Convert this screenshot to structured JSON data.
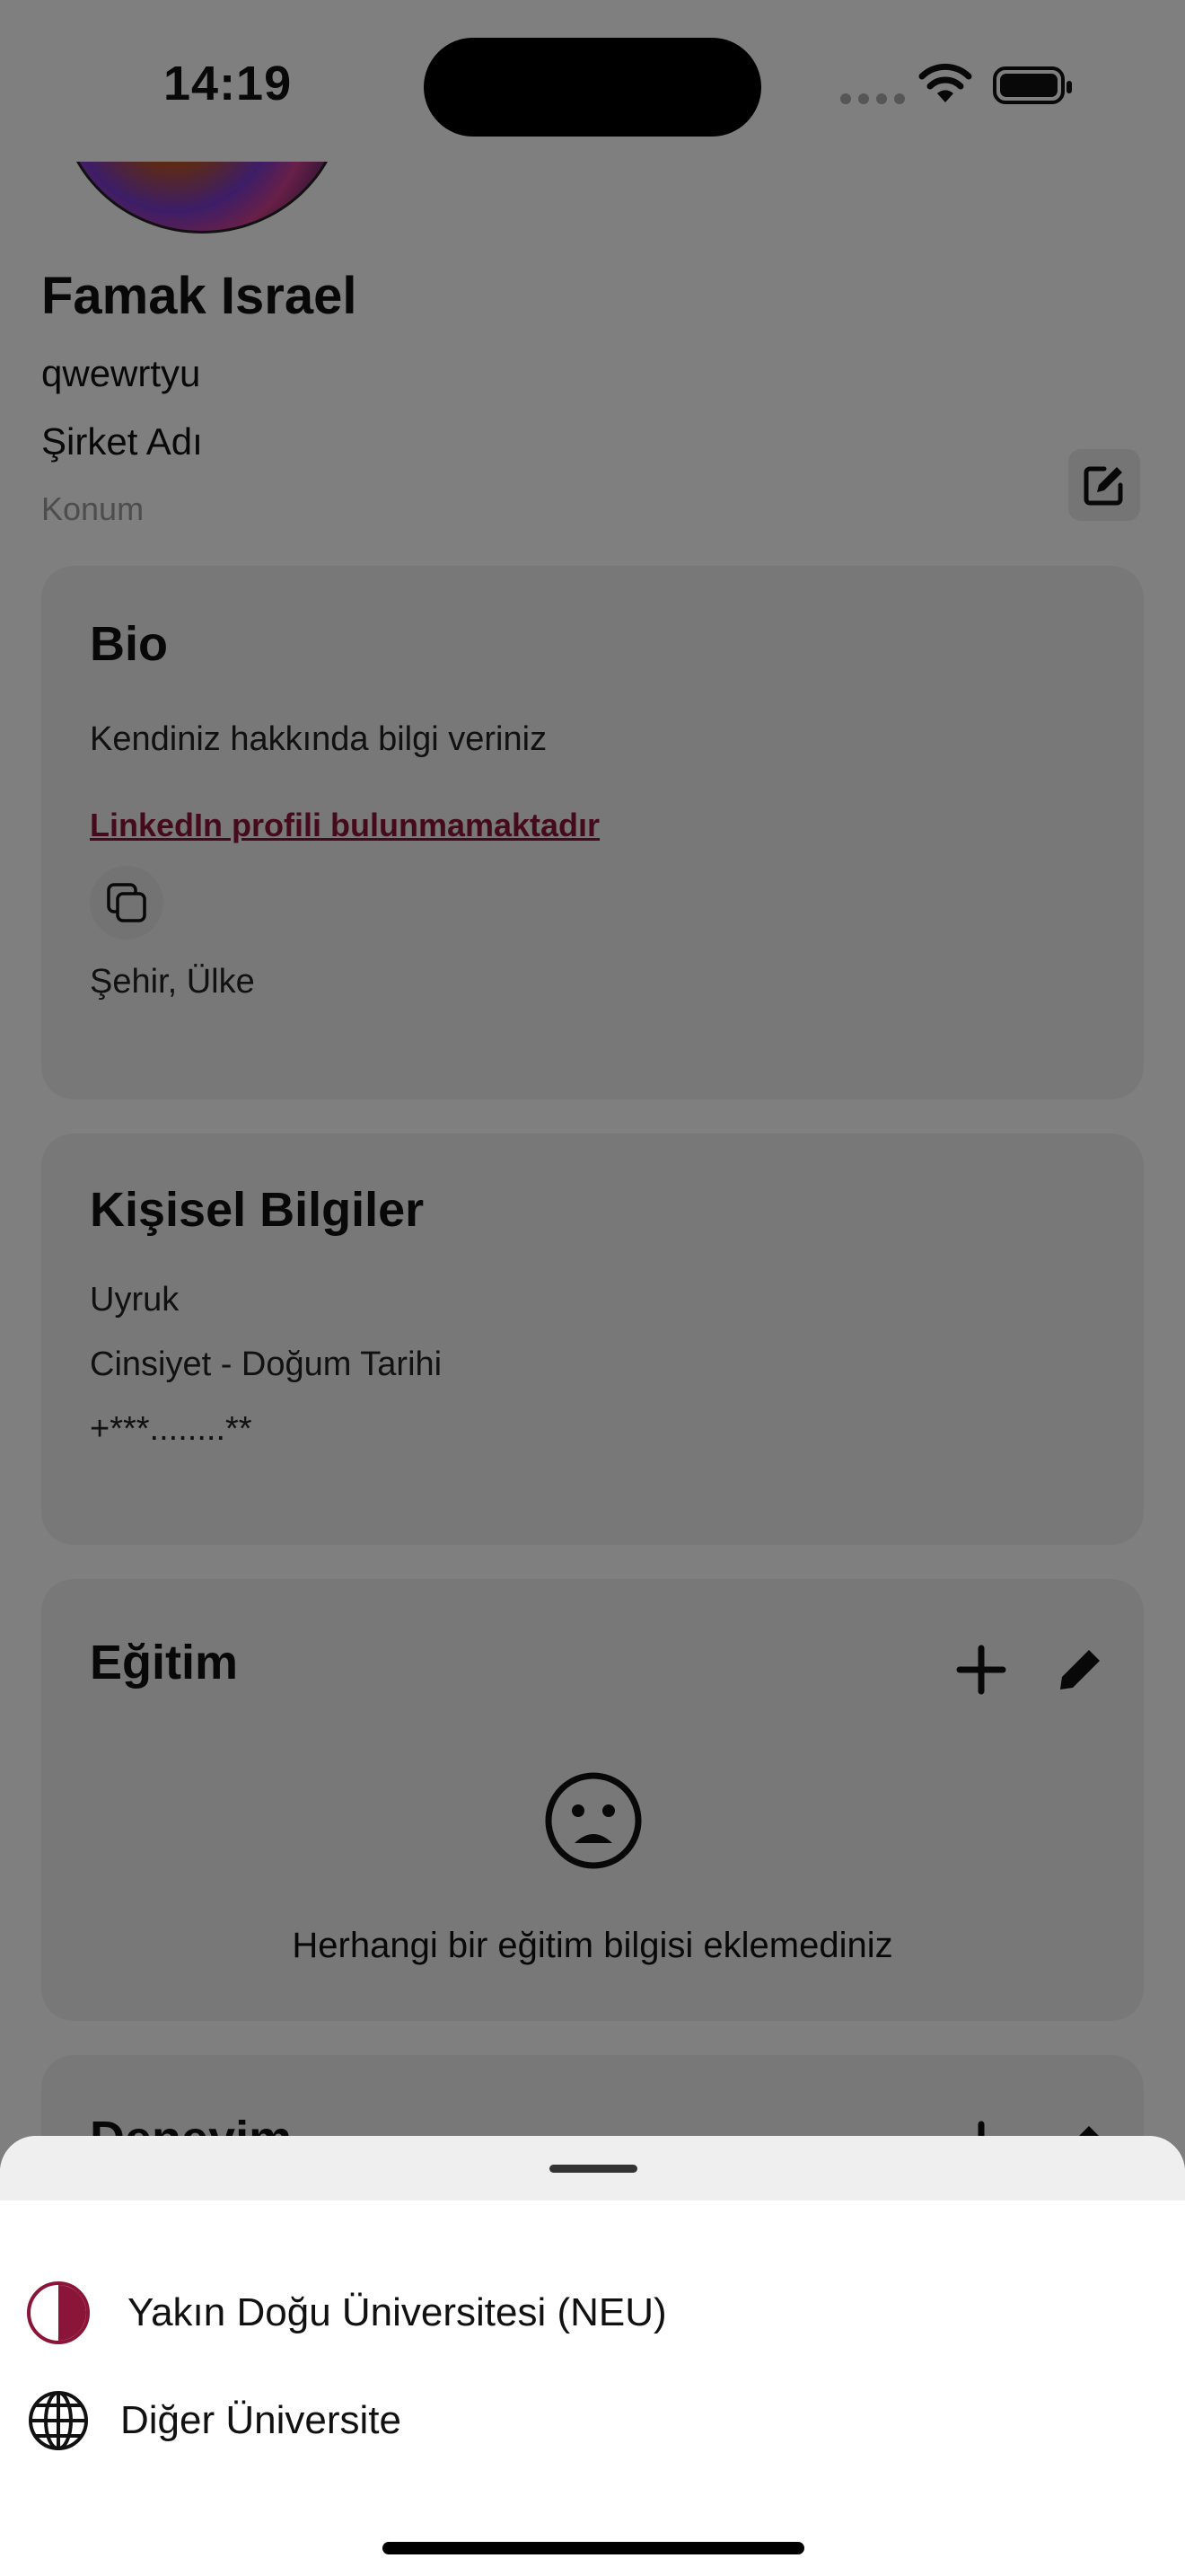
{
  "status_bar": {
    "time": "14:19"
  },
  "profile": {
    "name": "Famak Israel",
    "username": "qwewrtyu",
    "company": "Şirket Adı",
    "location_placeholder": "Konum"
  },
  "bio": {
    "title": "Bio",
    "description": "Kendiniz hakkında bilgi veriniz",
    "linkedin": "LinkedIn profili bulunmamaktadır",
    "city_country": "Şehir, Ülke"
  },
  "personal": {
    "title": "Kişisel Bilgiler",
    "nationality": "Uyruk",
    "gender_birth": "Cinsiyet  - Doğum Tarihi",
    "phone": "+***........**"
  },
  "education": {
    "title": "Eğitim",
    "empty_message": "Herhangi bir eğitim bilgisi eklemediniz"
  },
  "experience": {
    "title": "Deneyim"
  },
  "sheet": {
    "items": [
      {
        "label": "Yakın Doğu Üniversitesi (NEU)",
        "icon": "neu-logo-icon"
      },
      {
        "label": "Diğer Üniversite",
        "icon": "globe-icon"
      }
    ]
  },
  "colors": {
    "accent": "#8a1538",
    "overlay": "rgba(0,0,0,0.5)"
  }
}
